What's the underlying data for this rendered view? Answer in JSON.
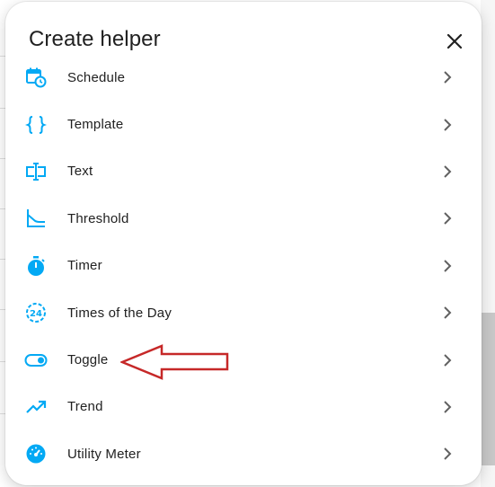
{
  "dialog": {
    "title": "Create helper",
    "close_icon": "close-icon"
  },
  "helpers": [
    {
      "label": "Schedule",
      "icon": "calendar-clock-icon"
    },
    {
      "label": "Template",
      "icon": "code-braces-icon"
    },
    {
      "label": "Text",
      "icon": "form-textbox-icon"
    },
    {
      "label": "Threshold",
      "icon": "threshold-icon"
    },
    {
      "label": "Timer",
      "icon": "timer-icon"
    },
    {
      "label": "Times of the Day",
      "icon": "hours-24-icon"
    },
    {
      "label": "Toggle",
      "icon": "toggle-switch-icon"
    },
    {
      "label": "Trend",
      "icon": "trending-up-icon"
    },
    {
      "label": "Utility Meter",
      "icon": "speedometer-icon"
    }
  ],
  "annotation": {
    "icon": "red-arrow-pointing-left",
    "target": "Toggle"
  },
  "colors": {
    "icon_blue": "#03a9f4",
    "text": "#212121",
    "chevron": "#616161",
    "annotation_red": "#c62828"
  }
}
